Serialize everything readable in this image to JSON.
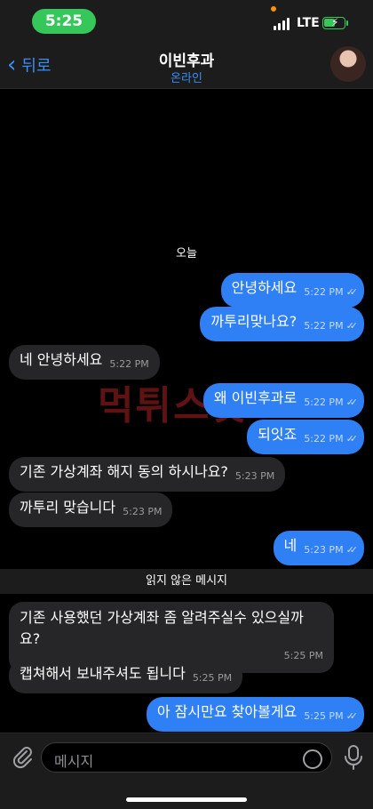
{
  "status": {
    "time": "5:25",
    "network": "LTE"
  },
  "header": {
    "back_label": "뒤로",
    "title": "이빈후과",
    "subtitle": "온라인"
  },
  "chat": {
    "date_label": "오늘",
    "messages": [
      {
        "dir": "out",
        "text": "안녕하세요",
        "time": "5:22 PM"
      },
      {
        "dir": "out",
        "text": "까투리맞나요?",
        "time": "5:22 PM"
      },
      {
        "dir": "in",
        "text": "네 안녕하세요",
        "time": "5:22 PM"
      },
      {
        "dir": "out",
        "text": "왜 이빈후과로",
        "time": "5:22 PM"
      },
      {
        "dir": "out",
        "text": "되잇죠",
        "time": "5:22 PM"
      },
      {
        "dir": "in",
        "text": "기존 가상계좌 해지 동의 하시나요?",
        "time": "5:23 PM"
      },
      {
        "dir": "in",
        "text": "까투리 맞습니다",
        "time": "5:23 PM"
      },
      {
        "dir": "out",
        "text": "네",
        "time": "5:23 PM"
      },
      {
        "dir": "in",
        "text": "기존 사용했던 가상계좌 좀 알려주실수 있으실까요?",
        "time": "5:25 PM"
      },
      {
        "dir": "in",
        "text": "캡쳐해서 보내주셔도 됩니다",
        "time": "5:25 PM"
      },
      {
        "dir": "out",
        "text": "아 잠시만요 찾아볼게요",
        "time": "5:25 PM"
      }
    ],
    "unread_label": "읽지 않은 메시지",
    "watermark": "먹튀스팟"
  },
  "input": {
    "placeholder": "메시지"
  },
  "colors": {
    "accent": "#3a8ef6",
    "outgoing": "#2f7ff5",
    "incoming": "#262628",
    "status_green": "#35c759"
  }
}
